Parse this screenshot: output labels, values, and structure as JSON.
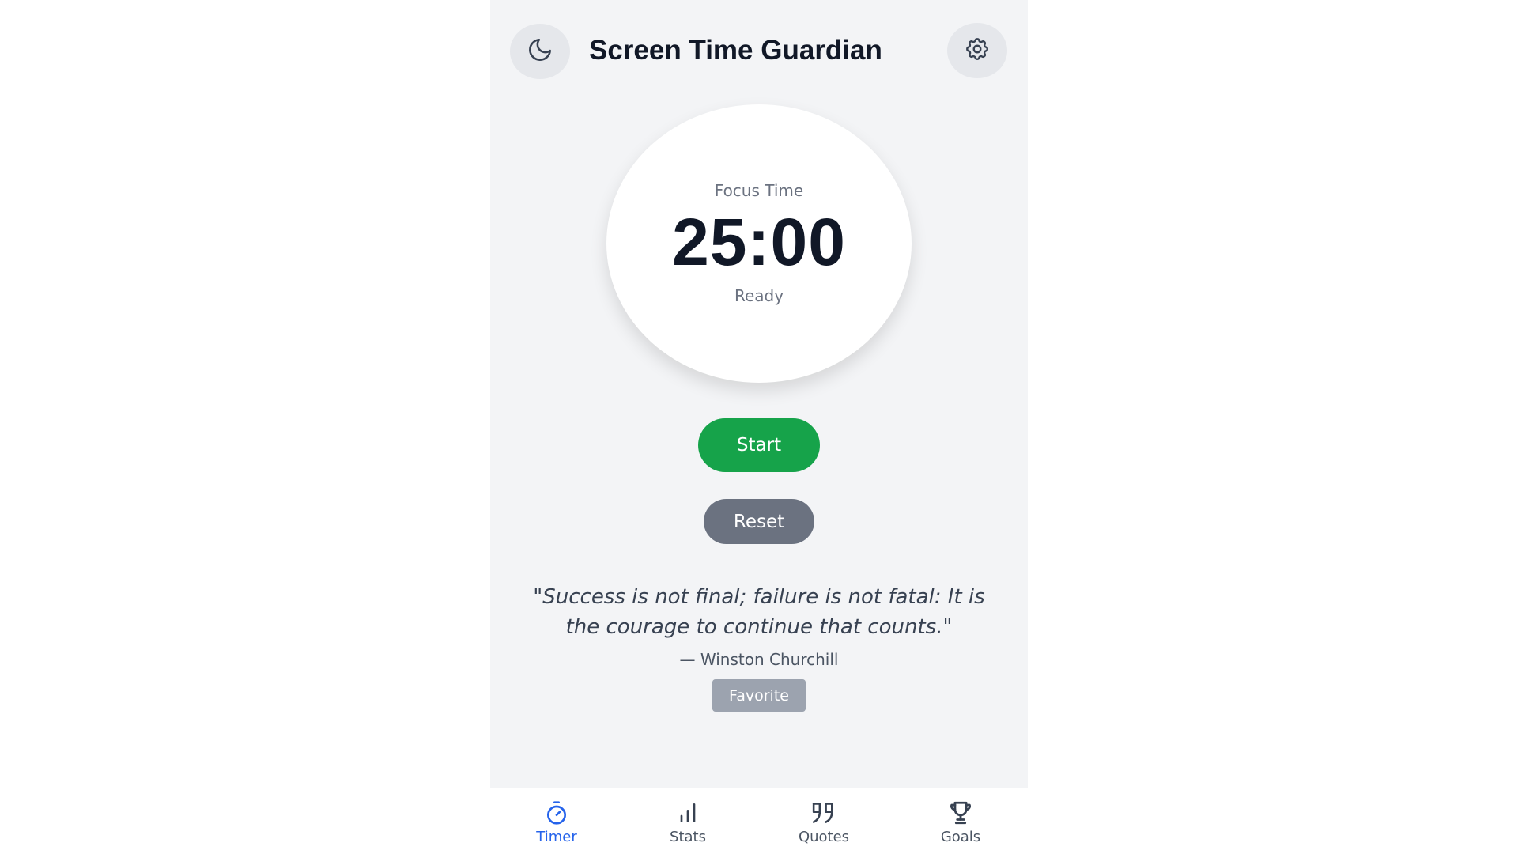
{
  "header": {
    "title": "Screen Time Guardian",
    "theme_toggle_icon": "moon-icon",
    "settings_icon": "gear-icon"
  },
  "timer": {
    "mode_label": "Focus Time",
    "time": "25:00",
    "status": "Ready"
  },
  "controls": {
    "start_label": "Start",
    "reset_label": "Reset"
  },
  "quote": {
    "text": "\"Success is not final; failure is not fatal: It is the courage to continue that counts.\"",
    "author": "— Winston Churchill",
    "favorite_label": "Favorite"
  },
  "nav": {
    "items": [
      {
        "label": "Timer",
        "icon": "stopwatch-icon",
        "active": true
      },
      {
        "label": "Stats",
        "icon": "bar-chart-icon",
        "active": false
      },
      {
        "label": "Quotes",
        "icon": "quote-icon",
        "active": false
      },
      {
        "label": "Goals",
        "icon": "trophy-icon",
        "active": false
      }
    ]
  },
  "colors": {
    "primary": "#16a34a",
    "secondary": "#6b7280",
    "active_nav": "#2563eb",
    "background": "#f3f4f6"
  }
}
